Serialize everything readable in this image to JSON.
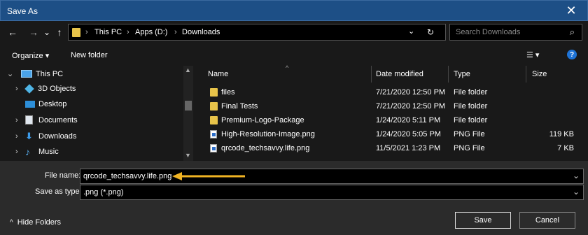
{
  "window": {
    "title": "Save As",
    "close_glyph": "✕"
  },
  "nav": {
    "back_glyph": "←",
    "forward_glyph": "→",
    "recent_glyph": "⌄",
    "up_glyph": "↑",
    "breadcrumbs": [
      "This PC",
      "Apps (D:)",
      "Downloads"
    ],
    "crumb_sep": "›",
    "dropdown_glyph": "⌄",
    "refresh_glyph": "↻",
    "search_placeholder": "Search Downloads",
    "search_glyph": "⌕"
  },
  "toolbar": {
    "organize_label": "Organize ▾",
    "new_folder_label": "New folder",
    "view_glyph": "☰ ▾",
    "help_glyph": "?"
  },
  "tree": {
    "items": [
      {
        "label": "This PC",
        "expander": "⌄"
      },
      {
        "label": "3D Objects",
        "expander": "›"
      },
      {
        "label": "Desktop",
        "expander": ""
      },
      {
        "label": "Documents",
        "expander": "›"
      },
      {
        "label": "Downloads",
        "expander": "›"
      },
      {
        "label": "Music",
        "expander": "›"
      }
    ]
  },
  "columns": {
    "name": "Name",
    "date": "Date modified",
    "type": "Type",
    "size": "Size"
  },
  "files": [
    {
      "name": "files",
      "date": "7/21/2020 12:50 PM",
      "type": "File folder",
      "size": "",
      "kind": "folder"
    },
    {
      "name": "Final Tests",
      "date": "7/21/2020 12:50 PM",
      "type": "File folder",
      "size": "",
      "kind": "folder"
    },
    {
      "name": "Premium-Logo-Package",
      "date": "1/24/2020 5:11 PM",
      "type": "File folder",
      "size": "",
      "kind": "folder"
    },
    {
      "name": "High-Resolution-Image.png",
      "date": "1/24/2020 5:05 PM",
      "type": "PNG File",
      "size": "119 KB",
      "kind": "png"
    },
    {
      "name": "qrcode_techsavvy.life.png",
      "date": "11/5/2021 1:23 PM",
      "type": "PNG File",
      "size": "7 KB",
      "kind": "png"
    }
  ],
  "form": {
    "file_name_label": "File name:",
    "file_name_value": "qrcode_techsavvy.life.png",
    "save_as_type_label": "Save as type:",
    "save_as_type_value": ".png (*.png)",
    "dropdown_glyph": "⌄"
  },
  "footer": {
    "hide_folders_label": "Hide Folders",
    "hide_folders_glyph": "^",
    "save_label": "Save",
    "cancel_label": "Cancel"
  },
  "colors": {
    "titlebar": "#1d4f86",
    "arrow": "#f0b323",
    "folder": "#e8c44a",
    "pane_bg": "#191919",
    "bottom_bg": "#2b2b2b"
  }
}
